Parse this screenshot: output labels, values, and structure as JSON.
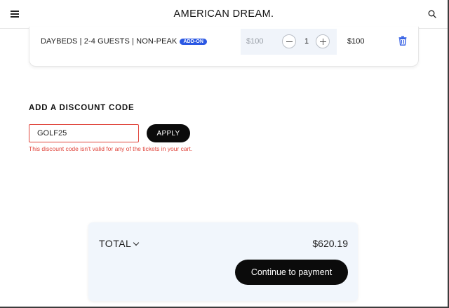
{
  "header": {
    "brand": "AMERICAN DREAM.",
    "menu_icon": "hamburger-menu-icon",
    "search_icon": "search-icon"
  },
  "cart_item": {
    "name": "DAYBEDS | 2-4 GUESTS | NON-PEAK",
    "badge": "ADD-ON",
    "unit_price": "$100",
    "quantity": "1",
    "line_total": "$100",
    "delete_icon": "trash-icon"
  },
  "discount": {
    "title": "ADD A DISCOUNT CODE",
    "code_value": "GOLF25",
    "apply_label": "APPLY",
    "error": "This discount code isn't valid for any of the tickets in your cart."
  },
  "summary": {
    "total_label": "TOTAL",
    "total_amount": "$620.19",
    "continue_label": "Continue to payment"
  },
  "colors": {
    "accent_blue": "#2b58e3",
    "error_red": "#e0443b",
    "button_black": "#0b0b0b",
    "summary_bg": "#f1f6fc"
  }
}
